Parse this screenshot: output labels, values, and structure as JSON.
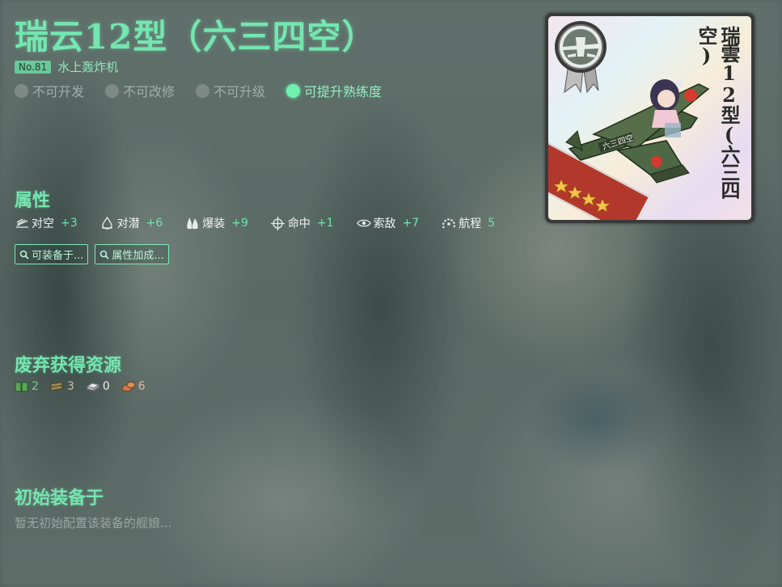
{
  "equipment": {
    "name": "瑞云12型（六三四空）",
    "number": "No.81",
    "type": "水上轰炸机",
    "card_name": "瑞雲12型(六三四空)"
  },
  "flags": [
    {
      "label": "不可开发",
      "active": false
    },
    {
      "label": "不可改修",
      "active": false
    },
    {
      "label": "不可升级",
      "active": false
    },
    {
      "label": "可提升熟练度",
      "active": true
    }
  ],
  "stats_section": {
    "title": "属性",
    "items": [
      {
        "label": "对空",
        "value": "+3",
        "icon": "anti-air-icon"
      },
      {
        "label": "对潜",
        "value": "+6",
        "icon": "anti-sub-icon"
      },
      {
        "label": "爆装",
        "value": "+9",
        "icon": "bomb-icon"
      },
      {
        "label": "命中",
        "value": "+1",
        "icon": "crosshair-icon"
      },
      {
        "label": "索敌",
        "value": "+7",
        "icon": "eye-icon"
      },
      {
        "label": "航程",
        "value": "5",
        "icon": "range-icon"
      }
    ],
    "buttons": [
      {
        "label": "可装备于..."
      },
      {
        "label": "属性加成..."
      }
    ]
  },
  "scrap_section": {
    "title": "废弃获得资源",
    "items": [
      {
        "kind": "fuel",
        "value": "2",
        "icon": "fuel-icon"
      },
      {
        "kind": "ammo",
        "value": "3",
        "icon": "ammo-icon"
      },
      {
        "kind": "steel",
        "value": "0",
        "icon": "steel-icon"
      },
      {
        "kind": "bauxite",
        "value": "6",
        "icon": "bauxite-icon"
      }
    ]
  },
  "initial_section": {
    "title": "初始装备于",
    "empty_text": "暂无初始配置该装备的舰娘..."
  },
  "colors": {
    "accent": "#74e6b0",
    "value": "#6fe7ad",
    "ribbon": "#b3382c"
  }
}
